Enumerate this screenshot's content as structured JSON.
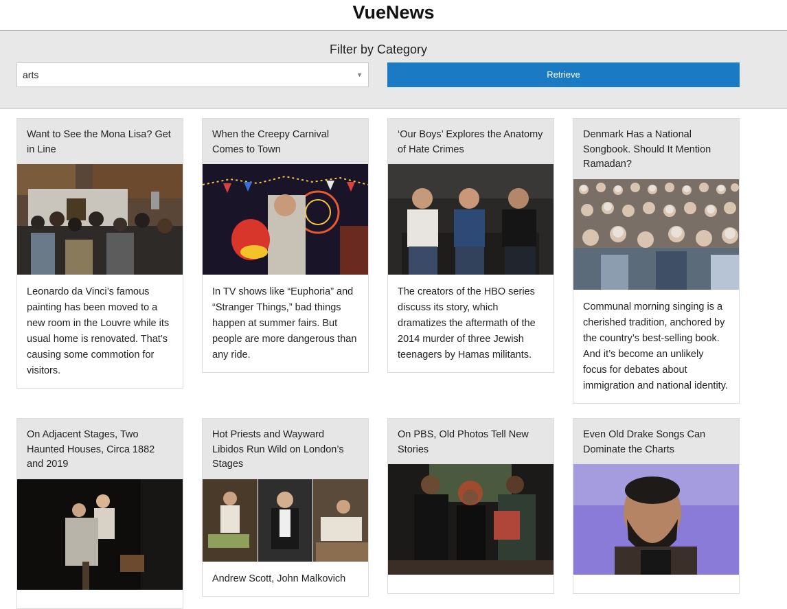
{
  "header": {
    "title": "VueNews"
  },
  "filter": {
    "label": "Filter by Category",
    "selected_category": "arts",
    "retrieve_label": "Retrieve"
  },
  "articles": [
    {
      "title": "Want to See the Mona Lisa? Get in Line",
      "abstract": "Leonardo da Vinci’s famous painting has been moved to a new room in the Louvre while its usual home is renovated. That’s causing some commotion for visitors."
    },
    {
      "title": "When the Creepy Carnival Comes to Town",
      "abstract": "In TV shows like “Euphoria” and “Stranger Things,” bad things happen at summer fairs. But people are more dangerous than any ride."
    },
    {
      "title": "‘Our Boys’ Explores the Anatomy of Hate Crimes",
      "abstract": "The creators of the HBO series discuss its story, which dramatizes the aftermath of the 2014 murder of three Jewish teenagers by Hamas militants."
    },
    {
      "title": "Denmark Has a National Songbook. Should It Mention Ramadan?",
      "abstract": "Communal morning singing is a cherished tradition, anchored by the country’s best-selling book. And it’s become an unlikely focus for debates about immigration and national identity."
    },
    {
      "title": "On Adjacent Stages, Two Haunted Houses, Circa 1882 and 2019",
      "abstract": ""
    },
    {
      "title": "Hot Priests and Wayward Libidos Run Wild on London’s Stages",
      "abstract": "Andrew Scott, John Malkovich"
    },
    {
      "title": "On PBS, Old Photos Tell New Stories",
      "abstract": ""
    },
    {
      "title": "Even Old Drake Songs Can Dominate the Charts",
      "abstract": ""
    }
  ]
}
